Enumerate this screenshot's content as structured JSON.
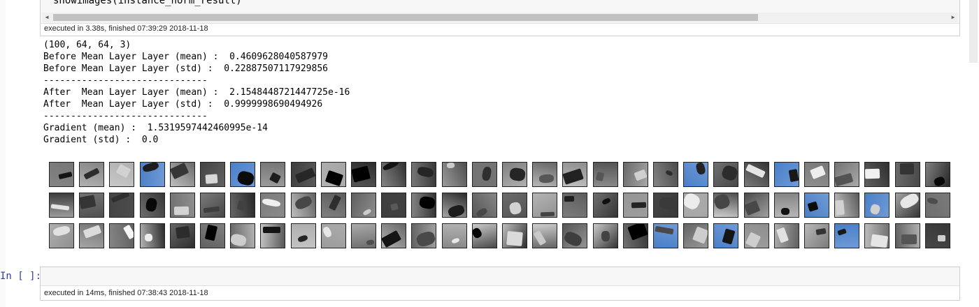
{
  "top_cell": {
    "code": "showimages(instance_norm_result)",
    "exec_info": "executed in 3.38s, finished 07:39:29 2018-11-18"
  },
  "output_lines": [
    "(100, 64, 64, 3)",
    "Before Mean Layer Layer (mean) :  0.4609628040587979",
    "Before Mean Layer Layer (std) :  0.22887507117929856",
    "------------------------------",
    "After  Mean Layer Layer (mean) :  2.1548448721447725e-16",
    "After  Mean Layer Layer (std) :  0.9999998690494926",
    "------------------------------",
    "Gradient (mean) :  1.5319597442460995e-14",
    "Gradient (std) :  0.0"
  ],
  "image_grid": {
    "rows": 3,
    "cols": 30
  },
  "bottom_cell": {
    "prompt": "In [ ]:",
    "exec_info": "executed in 14ms, finished 07:38:43 2018-11-18"
  },
  "colors": {
    "cell_border": "#cfcfcf",
    "code_bg": "#f7f7f7",
    "prompt": "#303f9f",
    "sky_blue": "#4a7fc7"
  }
}
